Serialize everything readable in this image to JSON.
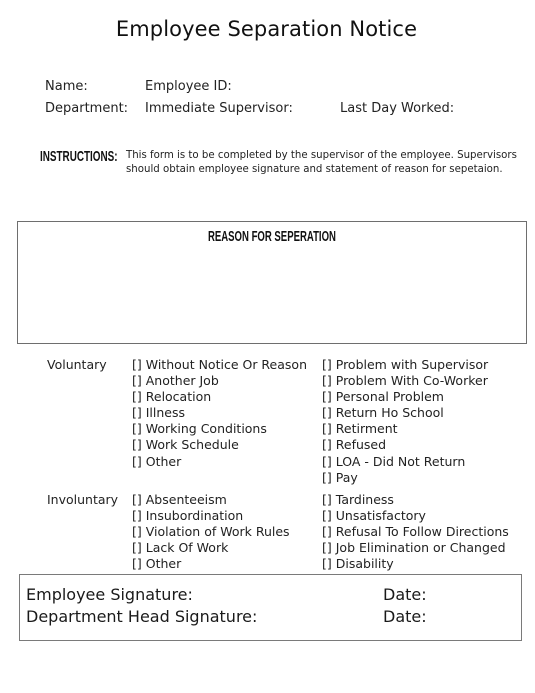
{
  "document": {
    "title": "Employee Separation Notice"
  },
  "fields": {
    "name": "Name:",
    "employee_id": "Employee ID:",
    "department": "Department:",
    "immediate_supervisor": "Immediate Supervisor:",
    "last_day_worked": "Last Day Worked:"
  },
  "instructions": {
    "label": "INSTRUCTIONS:",
    "text": "This form is to be completed by the supervisor of the employee. Supervisors should obtain employee signature and statement of reason for sepetaion."
  },
  "reason_box": {
    "title": "REASON FOR SEPERATION",
    "value": ""
  },
  "checkbox_glyph": "[]",
  "voluntary": {
    "label": "Voluntary",
    "left_options": [
      "Without Notice Or Reason",
      "Another Job",
      "Relocation",
      "Illness",
      "Working Conditions",
      "Work Schedule",
      "Other"
    ],
    "right_options": [
      "Problem with Supervisor",
      "Problem With Co-Worker",
      "Personal Problem",
      "Return Ho School",
      "Retirment",
      "Refused",
      "LOA - Did Not Return",
      "Pay"
    ]
  },
  "involuntary": {
    "label": "Involuntary",
    "left_options": [
      "Absenteeism",
      "Insubordination",
      "Violation of Work Rules",
      "Lack Of Work",
      "Other"
    ],
    "right_options": [
      "Tardiness",
      "Unsatisfactory",
      "Refusal To Follow Directions",
      "Job Elimination or Changed",
      "Disability"
    ]
  },
  "signatures": {
    "employee_signature": "Employee Signature:",
    "employee_date": "Date:",
    "dept_head_signature": "Department Head Signature:",
    "dept_head_date": "Date:"
  }
}
